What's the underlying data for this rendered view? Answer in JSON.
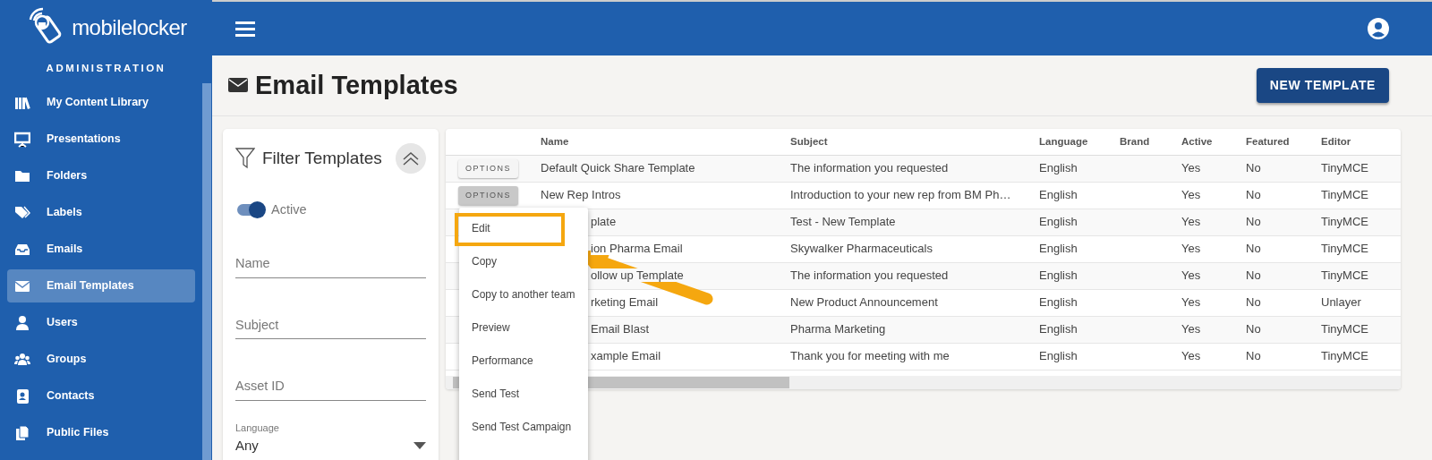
{
  "brand": {
    "name_light": "mobile",
    "name_bold": "locker"
  },
  "sidebar": {
    "heading": "ADMINISTRATION",
    "items": [
      {
        "label": "My Content Library",
        "selected": false
      },
      {
        "label": "Presentations",
        "selected": false
      },
      {
        "label": "Folders",
        "selected": false
      },
      {
        "label": "Labels",
        "selected": false
      },
      {
        "label": "Emails",
        "selected": false
      },
      {
        "label": "Email Templates",
        "selected": true
      },
      {
        "label": "Users",
        "selected": false
      },
      {
        "label": "Groups",
        "selected": false
      },
      {
        "label": "Contacts",
        "selected": false
      },
      {
        "label": "Public Files",
        "selected": false
      }
    ]
  },
  "page": {
    "title": "Email Templates",
    "new_button": "NEW TEMPLATE"
  },
  "filter": {
    "title": "Filter Templates",
    "toggle": {
      "label": "Active",
      "on": true
    },
    "fields": [
      {
        "placeholder": "Name"
      },
      {
        "placeholder": "Subject"
      },
      {
        "placeholder": "Asset ID"
      }
    ],
    "language": {
      "label": "Language",
      "value": "Any"
    }
  },
  "table": {
    "columns": [
      "Name",
      "Subject",
      "Language",
      "Brand",
      "Active",
      "Featured",
      "Editor"
    ],
    "rows": [
      {
        "options": {
          "label": "OPTIONS",
          "pressed": false
        },
        "cells": [
          "Default Quick Share Template",
          "The information you requested",
          "English",
          "",
          "Yes",
          "No",
          "TinyMCE"
        ]
      },
      {
        "options": {
          "label": "OPTIONS",
          "pressed": true
        },
        "cells": [
          "New Rep Intros",
          "Introduction to your new rep from BM Ph…",
          "English",
          "",
          "Yes",
          "No",
          "TinyMCE"
        ]
      },
      {
        "cells": [
          "plate",
          "Test - New Template",
          "English",
          "",
          "Yes",
          "No",
          "TinyMCE"
        ]
      },
      {
        "cells": [
          "ion Pharma Email",
          "Skywalker Pharmaceuticals",
          "English",
          "",
          "Yes",
          "No",
          "TinyMCE"
        ]
      },
      {
        "cells": [
          "ollow up Template",
          "The information you requested",
          "English",
          "",
          "Yes",
          "No",
          "TinyMCE"
        ]
      },
      {
        "cells": [
          "rketing Email",
          "New Product Announcement",
          "English",
          "",
          "Yes",
          "No",
          "Unlayer"
        ]
      },
      {
        "cells": [
          "Email Blast",
          "Pharma Marketing",
          "English",
          "",
          "Yes",
          "No",
          "TinyMCE"
        ]
      },
      {
        "cells": [
          "xample Email",
          "Thank you for meeting with me",
          "English",
          "",
          "Yes",
          "No",
          "TinyMCE"
        ]
      }
    ]
  },
  "options_menu": {
    "items": [
      {
        "label": "Edit",
        "highlighted": true
      },
      {
        "label": "Copy",
        "highlighted": false
      },
      {
        "label": "Copy to another team",
        "highlighted": false
      },
      {
        "label": "Preview",
        "highlighted": false
      },
      {
        "label": "Performance",
        "highlighted": false
      },
      {
        "label": "Send Test",
        "highlighted": false
      },
      {
        "label": "Send Test Campaign",
        "highlighted": false
      }
    ]
  }
}
